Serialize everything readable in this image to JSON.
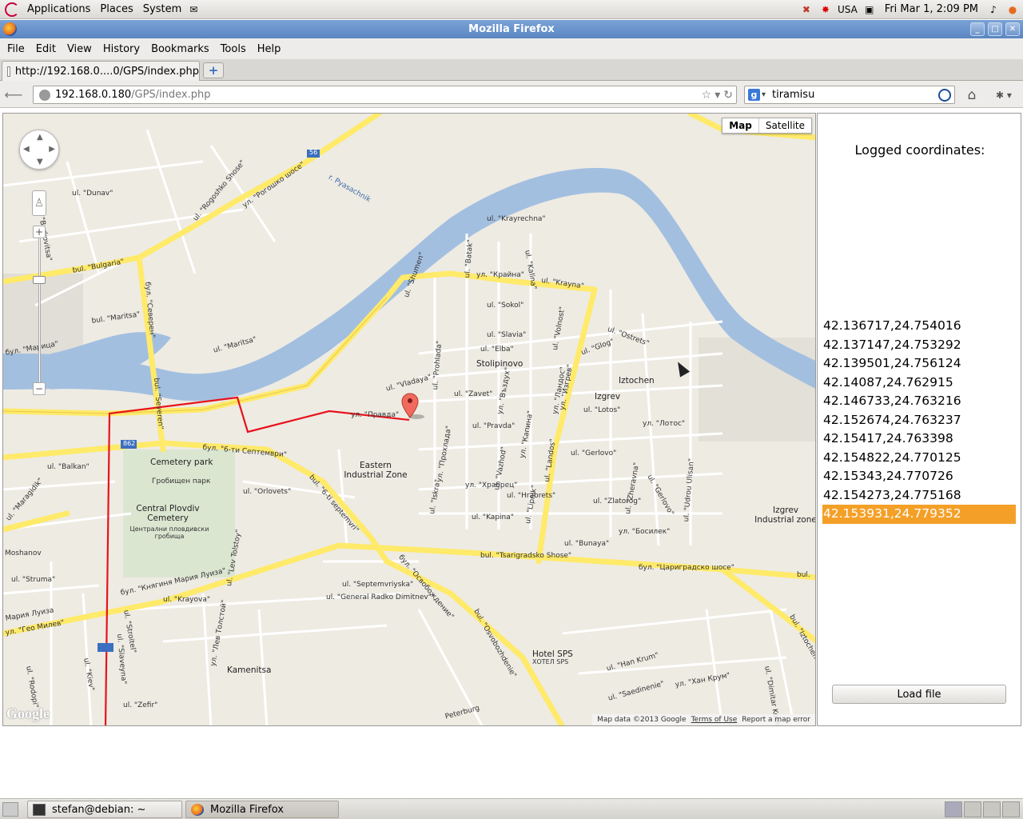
{
  "top_panel": {
    "menus": [
      "Applications",
      "Places",
      "System"
    ],
    "keyboard_layout": "USA",
    "clock": "Fri Mar  1,  2:09 PM"
  },
  "window": {
    "title": "Mozilla Firefox"
  },
  "menubar": {
    "items": [
      "File",
      "Edit",
      "View",
      "History",
      "Bookmarks",
      "Tools",
      "Help"
    ]
  },
  "tab": {
    "title": "http://192.168.0....0/GPS/index.php",
    "newtab_label": "+"
  },
  "navbar": {
    "url_host": "192.168.0.180",
    "url_path": "/GPS/index.php",
    "search_value": "tiramisu"
  },
  "map": {
    "type_buttons": {
      "map": "Map",
      "satellite": "Satellite"
    },
    "attribution": {
      "data": "Map data ©2013 Google",
      "terms": "Terms of Use",
      "report": "Report a map error"
    },
    "logo": "Google",
    "labels": [
      "ul. \"Dunav\"",
      "ul. \"Berkovitsa\"",
      "ul. \"Rogoshko Shose\"",
      "ул. \"Рогошко шосе\"",
      "r. Pyasachnik",
      "56",
      "bul. \"Bulgaria\"",
      "бул. \"Северен\"",
      "bul. \"Maritsa\"",
      "бул. \"Марица\"",
      "ul. \"Maritsa\"",
      "bul. \"Severen\"",
      "ul. \"Shumen\"",
      "ul. \"Batak\"",
      "ул. \"Крайна\"",
      "ul. \"Krayna\"",
      "ul. \"Krayrechna\"",
      "ul. \"Kalina\"",
      "ul. \"Sokol\"",
      "ul. \"Slavia\"",
      "ul. \"Elba\"",
      "ul. \"Volnost\"",
      "ul. \"Ostrets\"",
      "ul. \"Glog\"",
      "Stolipinovo",
      "Iztochen",
      "Izgrev",
      "ul. \"Vladaya\"",
      "ul. \"Zavet\"",
      "ул. \"Правда\"",
      "ul. \"Lotos\"",
      "ул. \"Лотос\"",
      "ul. \"Pravda\"",
      "ul. \"Prohlada\"",
      "862",
      "бул. \"6-ти Септември\"",
      "bul. \"6-ti septemvri\"",
      "Cemetery park",
      "Гробищен парк",
      "Eastern Industrial Zone",
      "ul. \"Balkan\"",
      "ul. \"Orlovets\"",
      "Central Plovdiv Cemetery",
      "Централни пловдивски гробища",
      "ul. \"Maragidik\"",
      "Moshanov",
      "ul. \"Struma\"",
      "ul. \"Hrabrets\"",
      "ул. \"Храбрец\"",
      "ul. \"Kapina\"",
      "ul. \"Gerlovo\"",
      "ul. \"Zlatorog\"",
      "ул. \"Босилек\"",
      "ul. \"Bunaya\"",
      "Izgrev Industrial zone",
      "ul. \"Landos\"",
      "bul. \"Tsarigradsko Shose\"",
      "бул. \"Цариградско шосе\"",
      "бул. \"Княгиня Мария Луиза\"",
      "ul. \"Krayova\"",
      "ul. \"Septemvriyska\"",
      "ul. \"General Radko Dimitnev\"",
      "ul. \"Lev Tolstoy\"",
      "ул. \"Лев Толстой\"",
      "Kamenitsa",
      "ul. \"Stroitel\"",
      "ul. \"Slaveyna\"",
      "ул. \"Гео Милев\"",
      "ul. \"Rodopi\"",
      "ul. \"Kiev\"",
      "ul. \"Zefir\"",
      "Hotel SPS",
      "ХОТЕЛ SPS",
      "ul. \"Han Krum\"",
      "ул. \"Хан Крум\"",
      "ul. \"Saedinenie\"",
      "bul. \"Osvobozhdenie\"",
      "бул. \"Освобождение\"",
      "Peterburg",
      "ul. \"Dimitar Kozhuh\"",
      "bul.",
      "Мария Луиза",
      "ул. \"Изгрев\"",
      "bul. \"Iztochen\"",
      "ul. \"Iskra\"",
      "ul. \"Vazhod\"",
      "ul. \"Lipnik\"",
      "ul. \"Zheravna\"",
      "ul. \"Udrou Ulisan\"",
      "ул. \"Ландос\"",
      "ул. \"Капина\"",
      "ул. \"Въздух\"",
      "ул. \"Прохлада\"",
      "ul. \"Gerlovo\""
    ]
  },
  "side_panel": {
    "title": "Logged coordinates:",
    "coordinates": [
      "42.136717,24.754016",
      "42.137147,24.753292",
      "42.139501,24.756124",
      "42.14087,24.762915",
      "42.146733,24.763216",
      "42.152674,24.763237",
      "42.15417,24.763398",
      "42.154822,24.770125",
      "42.15343,24.770726",
      "42.154273,24.775168",
      "42.153931,24.779352"
    ],
    "selected_index": 10,
    "load_button": "Load file"
  },
  "taskbar": {
    "tasks": [
      "stefan@debian: ~",
      "Mozilla Firefox"
    ]
  },
  "colors": {
    "route": "#e8121c",
    "major_road": "#ffea6a",
    "river": "#a3bfe0",
    "selected_row": "#f4a028",
    "titlebar": "#6690cc"
  }
}
